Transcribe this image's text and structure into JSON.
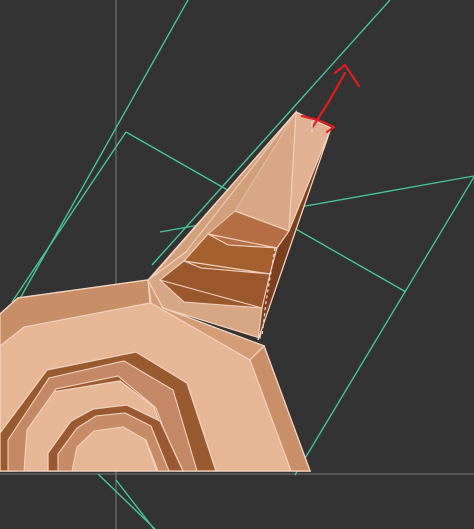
{
  "viewport": {
    "background_color": "#333333",
    "grid_line_color": "#6a6a6a",
    "construction_line_color": "#48c79a",
    "selection_color": "#e01e1e",
    "model_colors": {
      "light_face": "#e8b898",
      "mid_face": "#cc9670",
      "dark_face": "#9b5a31",
      "edge": "#f2d2bf"
    }
  },
  "scene": {
    "model": "spike-on-concentric-octagonal-rings",
    "gizmo": "move-arrow-gizmo",
    "ring_count": 2
  }
}
